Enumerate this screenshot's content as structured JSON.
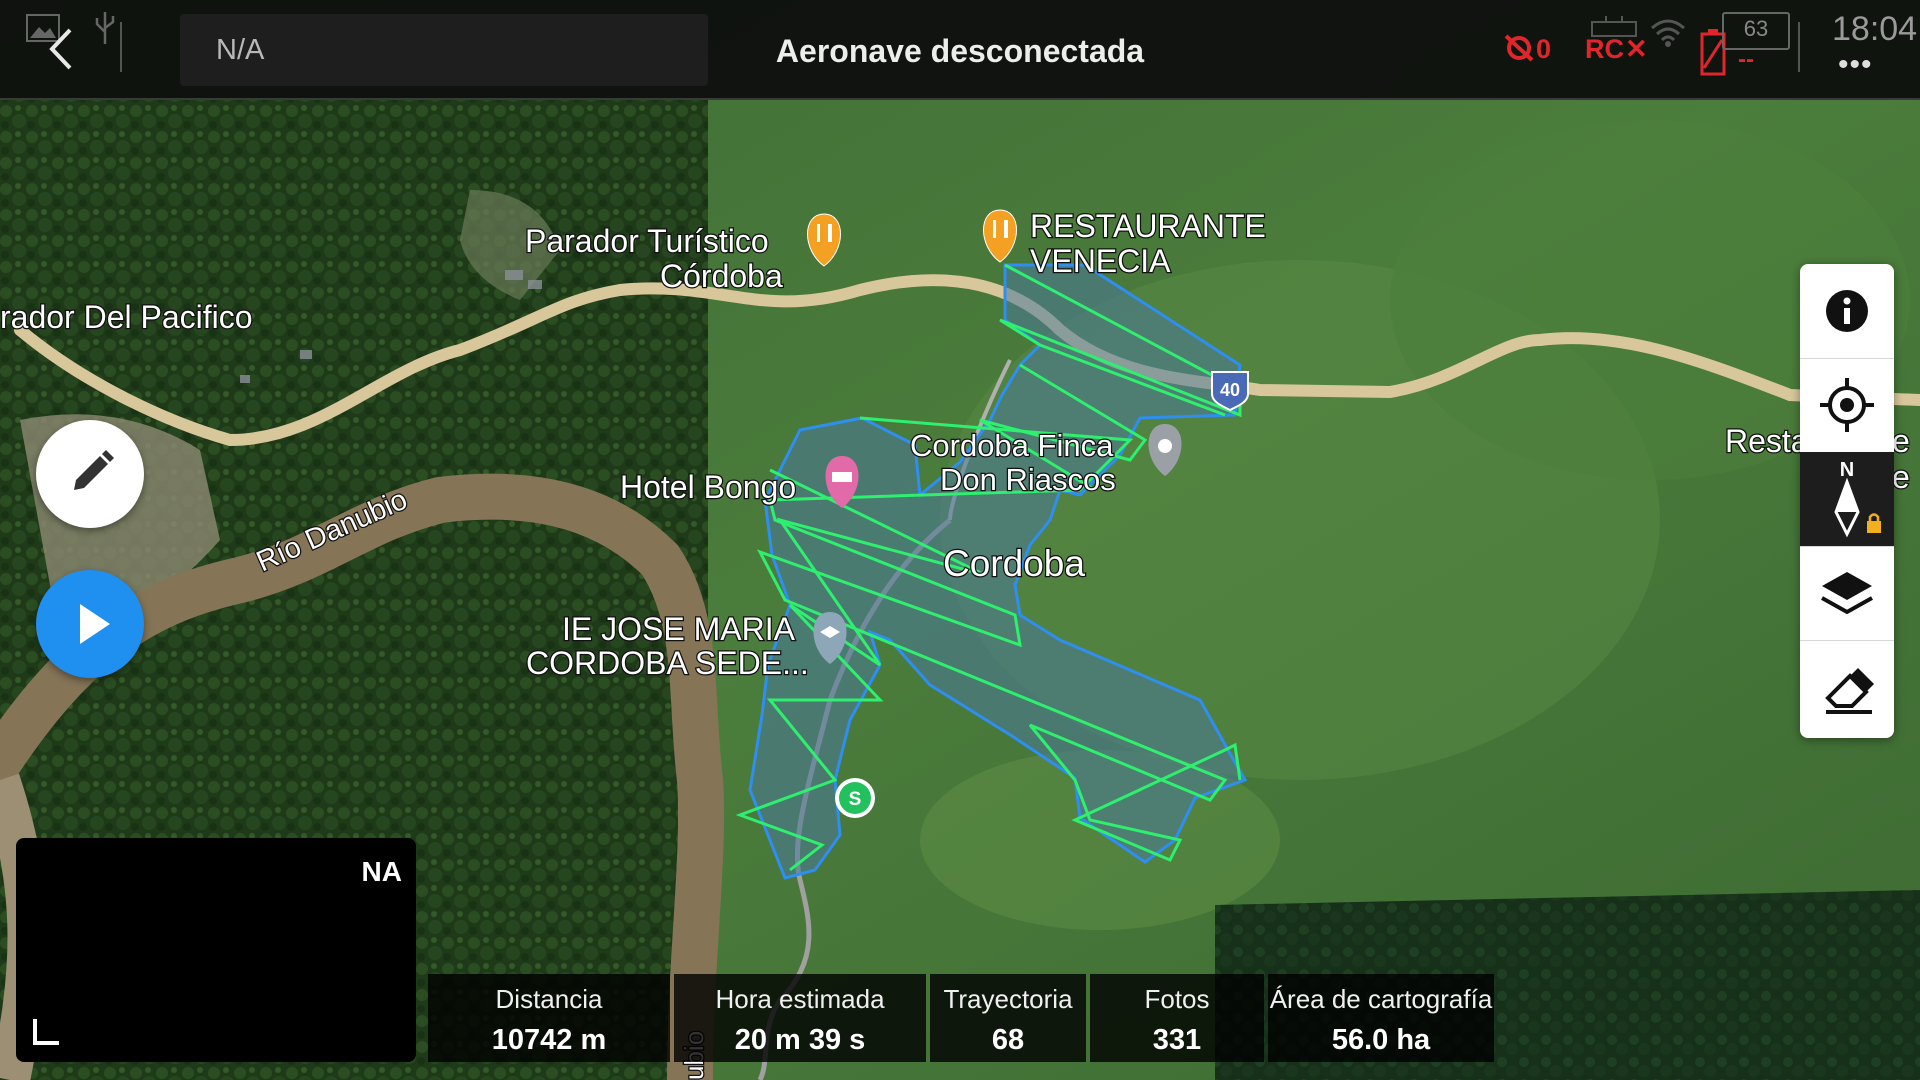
{
  "header": {
    "field_text": "N/A",
    "title": "Aeronave desconectada",
    "no_signal_count": "0",
    "rc_label": "RC",
    "rc_status": "✕",
    "drone_battery_text": "--",
    "rc_battery_level": "63",
    "clock": "18:04",
    "more_label": "•••"
  },
  "map": {
    "places": {
      "parador_pacifico": "rador Del Pacifico",
      "parador_turistico_1": "Parador Turístico",
      "parador_turistico_2": "Córdoba",
      "restaurante_1": "RESTAURANTE",
      "restaurante_2": "VENECIA",
      "finca_1": "Cordoba Finca",
      "finca_2": "Don Riascos",
      "hotel": "Hotel Bongo",
      "town": "Cordoba",
      "school_1": "IE JOSE MARIA",
      "school_2": "CORDOBA SEDE...",
      "river": "Río Danubio",
      "river_bottom": "ubio",
      "resta_right_1": "Resta",
      "resta_right_2": "e",
      "resta_right_3": "e"
    },
    "road_shield": "40",
    "start_marker": "S",
    "colors": {
      "survey_area_stroke": "#2e8ff0",
      "survey_area_fill": "#4a7a9a",
      "flight_path": "#2eef6e",
      "road": "#d8c79a",
      "river": "#8a7a5e"
    }
  },
  "controls": {
    "edit_icon": "pencil-icon",
    "play_icon": "play-icon",
    "toolbox": [
      "info-icon",
      "locate-icon",
      "compass-north-icon",
      "layers-icon",
      "eraser-icon"
    ],
    "compass_label": "N"
  },
  "camera_preview": {
    "label": "NA"
  },
  "stats": [
    {
      "label": "Distancia",
      "value": "10742 m"
    },
    {
      "label": "Hora estimada",
      "value": "20 m 39 s"
    },
    {
      "label": "Trayectoria",
      "value": "68"
    },
    {
      "label": "Fotos",
      "value": "331"
    },
    {
      "label": "Área de cartografía",
      "value": "56.0 ha"
    }
  ]
}
